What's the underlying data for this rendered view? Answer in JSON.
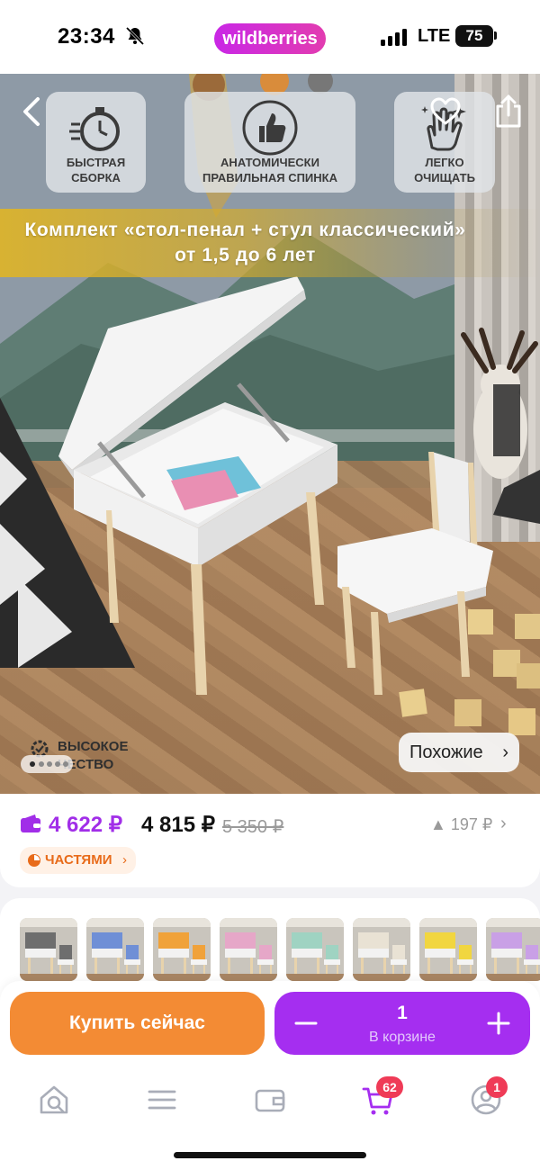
{
  "status_bar": {
    "time": "23:34",
    "brand": "wildberries",
    "network": "LTE",
    "battery": "75"
  },
  "hero": {
    "features": [
      {
        "icon": "stopwatch-icon",
        "line1": "БЫСТРАЯ",
        "line2": "СБОРКА"
      },
      {
        "icon": "thumbs-up-icon",
        "line1": "АНАТОМИЧЕСКИ",
        "line2": "ПРАВИЛЬНАЯ СПИНКА"
      },
      {
        "icon": "cleaning-hand-icon",
        "line1": "ЛЕГКО",
        "line2": "ОЧИЩАТЬ"
      }
    ],
    "banner_title": "Комплект «стол-пенал + стул классический»",
    "banner_subtitle": "от 1,5 до 6 лет",
    "quality_line1": "ВЫСОКОЕ",
    "quality_line2": "ЧЕСТВО",
    "similar_label": "Похожие",
    "similar_chevron": "›",
    "carousel": {
      "active_index": 0,
      "count": 5
    }
  },
  "price": {
    "wallet_price": "4 622 ₽",
    "price": "4 815 ₽",
    "old_price": "5 350 ₽",
    "price_change": "▲ 197 ₽",
    "price_change_arrow": "›",
    "installments_label": "ЧАСТЯМИ",
    "installments_chevron": "›",
    "colors": {
      "wallet": "#a12ee8",
      "installments": "#e86b1a"
    }
  },
  "thumbnails": [
    {
      "color": "#6e6e6e",
      "name": "variant-black"
    },
    {
      "color": "#6f8fd6",
      "name": "variant-blue"
    },
    {
      "color": "#f0a23a",
      "name": "variant-orange"
    },
    {
      "color": "#e6a7c8",
      "name": "variant-pink"
    },
    {
      "color": "#9fd3c2",
      "name": "variant-mint"
    },
    {
      "color": "#e9e2d4",
      "name": "variant-beige"
    },
    {
      "color": "#f1d640",
      "name": "variant-yellow"
    },
    {
      "color": "#c9a0e6",
      "name": "variant-lilac"
    }
  ],
  "actions": {
    "buy_now": "Купить сейчас",
    "quantity": "1",
    "in_cart": "В корзине",
    "colors": {
      "buy": "#f38b34",
      "cart": "#a52ef0"
    }
  },
  "tabbar": {
    "items": [
      {
        "name": "home",
        "icon": "search-home-icon"
      },
      {
        "name": "catalog",
        "icon": "menu-icon"
      },
      {
        "name": "wallet",
        "icon": "wallet-icon"
      },
      {
        "name": "cart",
        "icon": "cart-icon",
        "badge": "62"
      },
      {
        "name": "profile",
        "icon": "profile-icon",
        "badge": "1"
      }
    ]
  }
}
